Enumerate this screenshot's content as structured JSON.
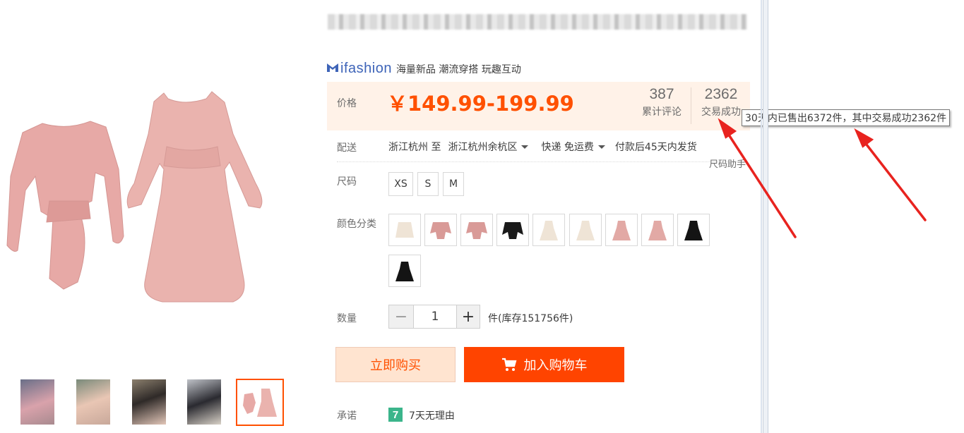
{
  "brand": {
    "name": "ifashion",
    "slogan": "海量新品 潮流穿搭 玩趣互动"
  },
  "price": {
    "label": "价格",
    "value": "￥149.99-199.99",
    "color": "#ff5000"
  },
  "stats": {
    "reviews": {
      "count": "387",
      "label": "累计评论"
    },
    "deals": {
      "count": "2362",
      "label": "交易成功"
    }
  },
  "tooltip": "30天内已售出6372件，其中交易成功2362件",
  "delivery": {
    "label": "配送",
    "from": "浙江杭州 至",
    "to": "浙江杭州余杭区",
    "express": "快递 免运费",
    "ship_time": "付款后45天内发货"
  },
  "size": {
    "label": "尺码",
    "helper": "尺码助手",
    "options": [
      "XS",
      "S",
      "M"
    ]
  },
  "color": {
    "label": "颜色分类"
  },
  "quantity": {
    "label": "数量",
    "value": "1",
    "minus": "−",
    "plus": "+",
    "stock": "件(库存151756件)"
  },
  "actions": {
    "buy_now": "立即购买",
    "add_to_cart": "加入购物车"
  },
  "promise": {
    "label": "承诺",
    "icon_text": "7",
    "text": "7天无理由"
  },
  "colors": {
    "accent": "#ff5000",
    "cart_bg": "#ff4400",
    "price_bg": "#fff2e8",
    "brand_blue": "#3e64b8",
    "promise_green": "#3bb58b"
  }
}
